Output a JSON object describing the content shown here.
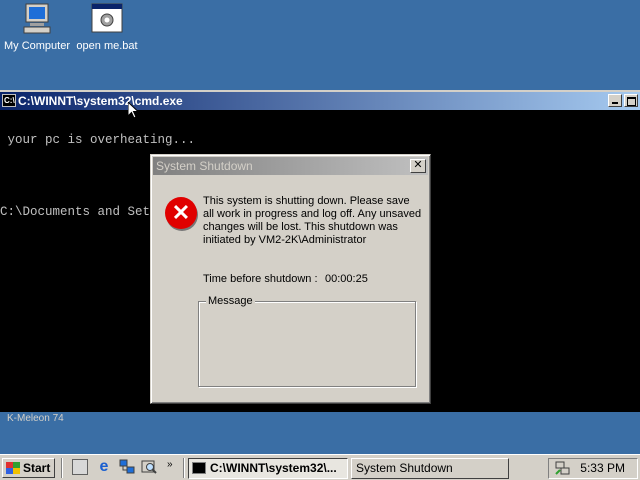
{
  "desktop": {
    "icons": [
      {
        "label": "My Computer",
        "icon": "my-computer-icon"
      },
      {
        "label": "open me.bat",
        "icon": "batch-file-icon"
      }
    ],
    "background_color": "#3a6ea5"
  },
  "cmd_window": {
    "title": "C:\\WINNT\\system32\\cmd.exe",
    "lines": [
      " your pc is overheating...",
      "",
      "C:\\Documents and Settings\\Administrator\\Desktop>"
    ],
    "text_color": "#c0c0c0",
    "background_color": "#000000"
  },
  "dialog": {
    "title": "System Shutdown",
    "icon": "error-x-icon",
    "message": "This system is shutting down. Please save all work in progress and log off. Any unsaved changes will be lost. This shutdown was initiated by VM2-2K\\Administrator",
    "time_label": "Time before shutdown :",
    "time_value": "00:00:25",
    "message_group_label": "Message",
    "close_glyph": "✕"
  },
  "background_window": {
    "label": "K-Meleon 74"
  },
  "taskbar": {
    "start_label": "Start",
    "quick_launch": [
      "show-desktop-icon",
      "internet-explorer-icon",
      "network-icon",
      "search-icon"
    ],
    "more_glyph": "»",
    "tasks": [
      {
        "label": "C:\\WINNT\\system32\\...",
        "active": true
      },
      {
        "label": "System Shutdown",
        "active": false
      }
    ],
    "clock": "5:33 PM"
  }
}
